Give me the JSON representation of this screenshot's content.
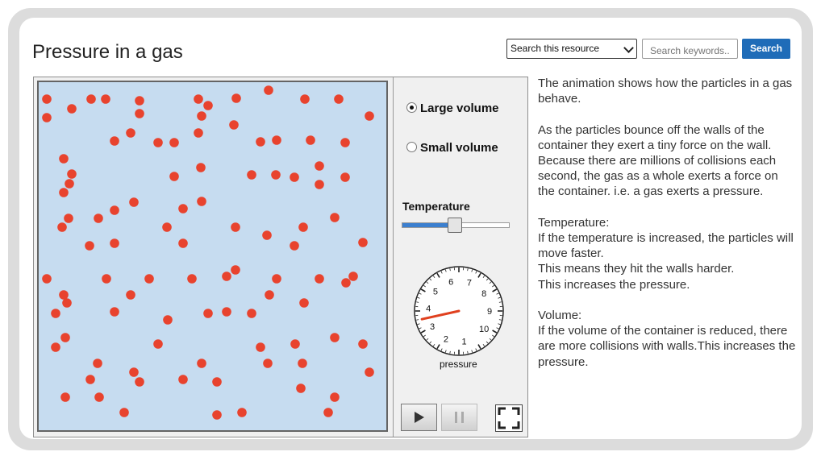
{
  "header": {
    "title": "Pressure in a gas",
    "search_scope": "Search this resource",
    "search_placeholder": "Search keywords..",
    "search_button": "Search"
  },
  "simulation": {
    "volume_options": [
      {
        "label": "Large volume",
        "selected": true
      },
      {
        "label": "Small volume",
        "selected": false
      }
    ],
    "temperature_label": "Temperature",
    "temperature_level": 0.5,
    "gauge": {
      "ticks": [
        "1",
        "2",
        "3",
        "4",
        "5",
        "6",
        "7",
        "8",
        "9",
        "10"
      ],
      "reading": 3.5,
      "label": "pressure",
      "needle_color": "#e0401e"
    },
    "particle_color": "#e8432e",
    "container_color": "#c6dcf0",
    "buttons": {
      "play": "play-icon",
      "pause": "pause-icon",
      "fullscreen": "fullscreen-icon"
    }
  },
  "description": {
    "intro": "The animation shows how the particles in a gas behave.",
    "walls": "As the particles bounce off the walls of the container they exert a tiny force on the wall. Because there are millions of collisions each second, the gas as a whole exerts a force on the container. i.e. a gas exerts a pressure.",
    "temperature_heading": "Temperature:",
    "temperature_lines": [
      "If the temperature is increased, the particles will move faster.",
      "This means they hit the walls harder.",
      "This increases the pressure."
    ],
    "volume_heading": "Volume:",
    "volume_text": "If the volume of the container is reduced, there are more collisions with walls.This increases the pressure."
  }
}
